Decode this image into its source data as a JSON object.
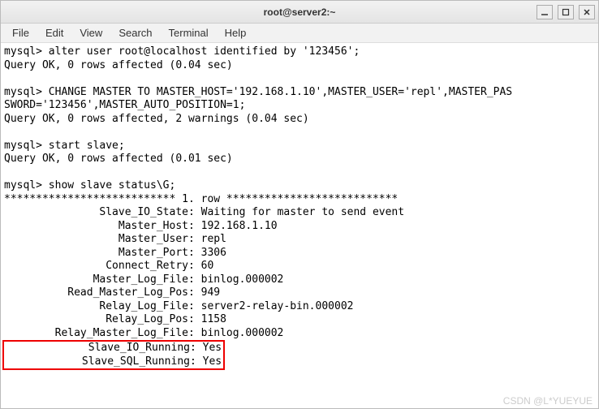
{
  "titlebar": {
    "title": "root@server2:~"
  },
  "menubar": {
    "file": "File",
    "edit": "Edit",
    "view": "View",
    "search": "Search",
    "terminal": "Terminal",
    "help": "Help"
  },
  "terminal": {
    "l1": "mysql> alter user root@localhost identified by '123456';",
    "l2": "Query OK, 0 rows affected (0.04 sec)",
    "l3": "",
    "l4": "mysql> CHANGE MASTER TO MASTER_HOST='192.168.1.10',MASTER_USER='repl',MASTER_PAS",
    "l5": "SWORD='123456',MASTER_AUTO_POSITION=1;",
    "l6": "Query OK, 0 rows affected, 2 warnings (0.04 sec)",
    "l7": "",
    "l8": "mysql> start slave;",
    "l9": "Query OK, 0 rows affected (0.01 sec)",
    "l10": "",
    "l11": "mysql> show slave status\\G;",
    "l12": "*************************** 1. row ***************************",
    "l13": "               Slave_IO_State: Waiting for master to send event",
    "l14": "                  Master_Host: 192.168.1.10",
    "l15": "                  Master_User: repl",
    "l16": "                  Master_Port: 3306",
    "l17": "                Connect_Retry: 60",
    "l18": "              Master_Log_File: binlog.000002",
    "l19": "          Read_Master_Log_Pos: 949",
    "l20": "               Relay_Log_File: server2-relay-bin.000002",
    "l21": "                Relay_Log_Pos: 1158",
    "l22": "        Relay_Master_Log_File: binlog.000002",
    "h1": "             Slave_IO_Running: Yes",
    "h2": "            Slave_SQL_Running: Yes"
  },
  "watermark": "CSDN @L*YUEYUE"
}
